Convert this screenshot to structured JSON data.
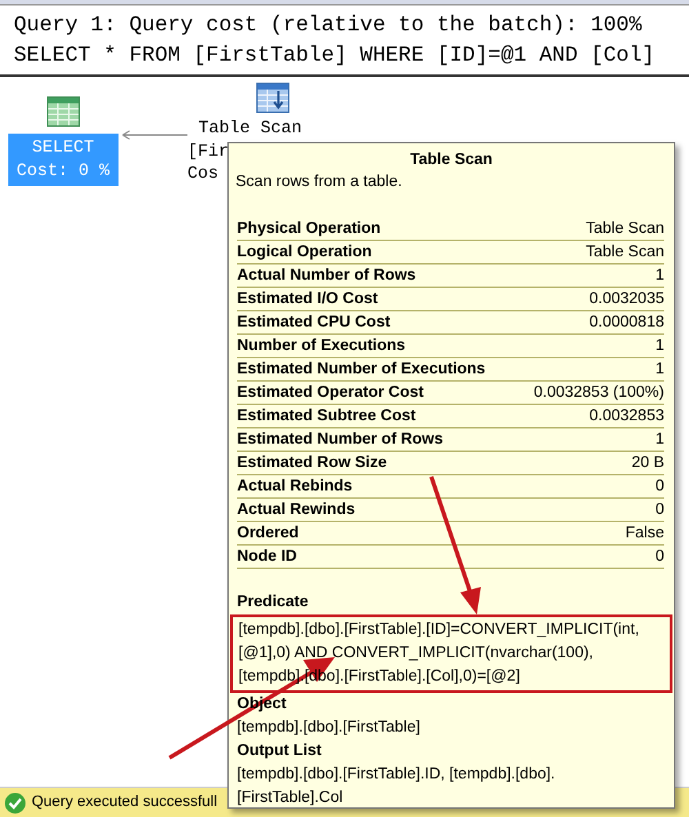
{
  "query_header": {
    "cost_line": "Query 1: Query cost (relative to the batch): 100%",
    "sql_line": "SELECT * FROM [FirstTable] WHERE [ID]=@1 AND [Col]"
  },
  "plan": {
    "nodes": [
      {
        "kind": "select",
        "label": "SELECT",
        "cost": "Cost: 0 %",
        "selected": true
      },
      {
        "kind": "scan",
        "label": "Table Scan",
        "lines": [
          "[Fir",
          "Cos"
        ],
        "selected": false
      }
    ]
  },
  "tooltip": {
    "title": "Table Scan",
    "description": "Scan rows from a table.",
    "properties": [
      {
        "name": "Physical Operation",
        "value": "Table Scan"
      },
      {
        "name": "Logical Operation",
        "value": "Table Scan"
      },
      {
        "name": "Actual Number of Rows",
        "value": "1"
      },
      {
        "name": "Estimated I/O Cost",
        "value": "0.0032035"
      },
      {
        "name": "Estimated CPU Cost",
        "value": "0.0000818"
      },
      {
        "name": "Number of Executions",
        "value": "1"
      },
      {
        "name": "Estimated Number of Executions",
        "value": "1"
      },
      {
        "name": "Estimated Operator Cost",
        "value": "0.0032853 (100%)"
      },
      {
        "name": "Estimated Subtree Cost",
        "value": "0.0032853"
      },
      {
        "name": "Estimated Number of Rows",
        "value": "1"
      },
      {
        "name": "Estimated Row Size",
        "value": "20 B"
      },
      {
        "name": "Actual Rebinds",
        "value": "0"
      },
      {
        "name": "Actual Rewinds",
        "value": "0"
      },
      {
        "name": "Ordered",
        "value": "False"
      },
      {
        "name": "Node ID",
        "value": "0"
      }
    ],
    "sections": [
      {
        "heading": "Predicate",
        "lines": [
          "[tempdb].[dbo].[FirstTable].[ID]=CONVERT_IMPLICIT(int,",
          "[@1],0) AND CONVERT_IMPLICIT(nvarchar(100),",
          "[tempdb].[dbo].[FirstTable].[Col],0)=[@2]"
        ],
        "highlighted": true
      },
      {
        "heading": "Object",
        "lines": [
          "[tempdb].[dbo].[FirstTable]"
        ],
        "highlighted": false
      },
      {
        "heading": "Output List",
        "lines": [
          "[tempdb].[dbo].[FirstTable].ID, [tempdb].[dbo].",
          "[FirstTable].Col"
        ],
        "highlighted": false
      }
    ]
  },
  "status_bar": {
    "message": "Query executed successfull"
  }
}
